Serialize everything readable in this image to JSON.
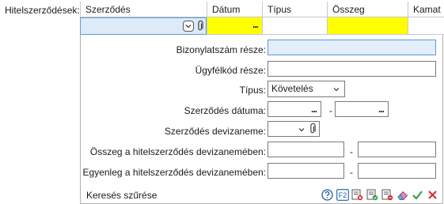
{
  "field_label": "Hitelszerződések:",
  "grid": {
    "columns": [
      "Szerződés",
      "Dátum",
      "Típus",
      "Összeg",
      "Kamat"
    ]
  },
  "filter": {
    "bizonylatszam_label": "Bizonylatszám része:",
    "ugyfelkod_label": "Ügyfélkód része:",
    "tipus_label": "Típus:",
    "tipus_value": "Követelés",
    "datum_label": "Szerződés dátuma:",
    "range_separator": "-",
    "devizanem_label": "Szerződés devizaneme:",
    "osszeg_label": "Összeg a hitelszerződés devizanemében:",
    "egyenleg_label": "Egyenleg a hitelszerződés devizanemében:",
    "date_button": "...",
    "footer_label": "Keresés szűrése",
    "f2_label": "F2"
  },
  "colors": {
    "selected_cell": "#dcebf7",
    "highlight_cell": "#ffff00",
    "focus_input": "#e3eefa",
    "accept": "#2e9b3a",
    "cancel": "#d62828",
    "help": "#1f5fa8"
  },
  "icons": {
    "help": "question-circle-icon",
    "f2": "f2-key-icon",
    "clear_filter": "filter-clear-icon",
    "save_filter": "filter-save-icon",
    "delete_filter": "filter-delete-icon",
    "eraser": "eraser-icon",
    "accept": "checkmark-icon",
    "cancel": "cross-icon"
  }
}
